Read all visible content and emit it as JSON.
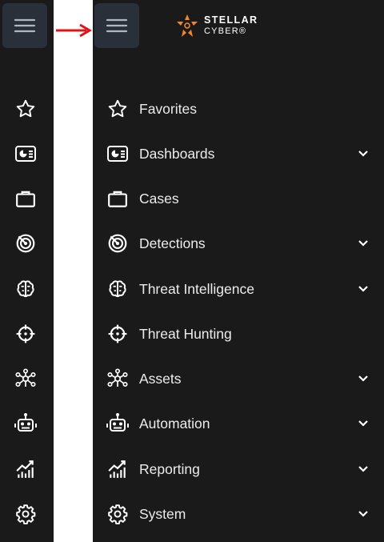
{
  "logo": {
    "line1": "STELLAR",
    "line2": "CYBER®",
    "accent_color": "#f0852e"
  },
  "arrow_color": "#e01414",
  "sidebar": {
    "items": [
      {
        "label": "Favorites",
        "icon": "star-icon",
        "has_submenu": false
      },
      {
        "label": "Dashboards",
        "icon": "dashboard-icon",
        "has_submenu": true
      },
      {
        "label": "Cases",
        "icon": "briefcase-icon",
        "has_submenu": false
      },
      {
        "label": "Detections",
        "icon": "radar-icon",
        "has_submenu": true
      },
      {
        "label": "Threat Intelligence",
        "icon": "brain-icon",
        "has_submenu": true
      },
      {
        "label": "Threat Hunting",
        "icon": "crosshair-icon",
        "has_submenu": false
      },
      {
        "label": "Assets",
        "icon": "network-icon",
        "has_submenu": true
      },
      {
        "label": "Automation",
        "icon": "robot-icon",
        "has_submenu": true
      },
      {
        "label": "Reporting",
        "icon": "chart-icon",
        "has_submenu": true
      },
      {
        "label": "System",
        "icon": "gear-icon",
        "has_submenu": true
      }
    ]
  }
}
